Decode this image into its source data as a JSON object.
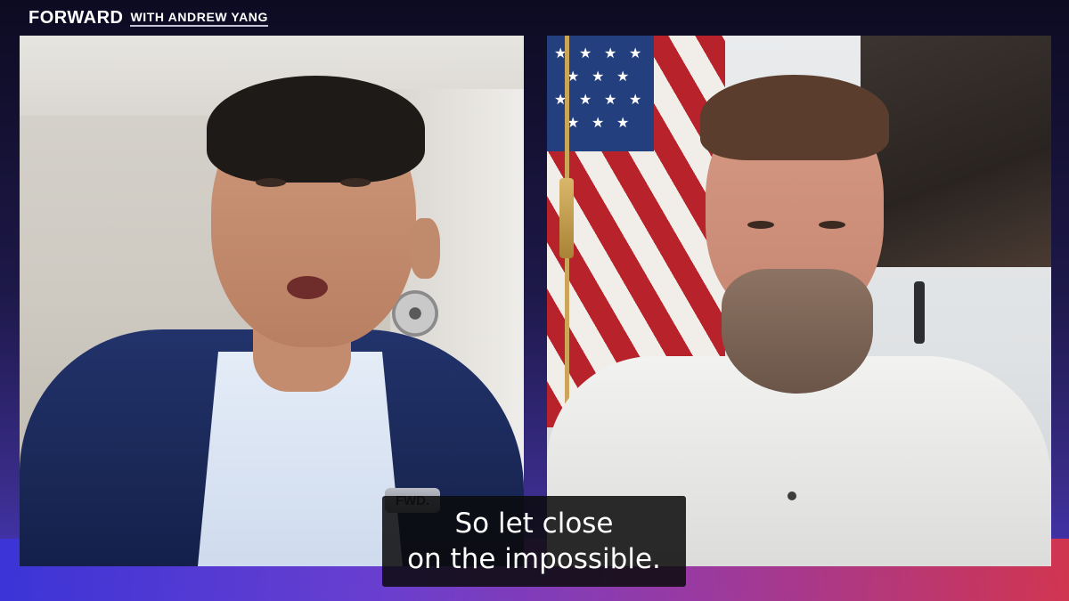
{
  "header": {
    "brand_name": "FORWARD",
    "brand_sub": "WITH ANDREW YANG"
  },
  "left_tile": {
    "pin_text": "FWD."
  },
  "caption": {
    "line1": "So let close",
    "line2": "on the impossible."
  },
  "colors": {
    "frame_bottom_left": "#3b34d8",
    "frame_bottom_right": "#d8354a",
    "caption_bg": "#0a0a0c"
  }
}
